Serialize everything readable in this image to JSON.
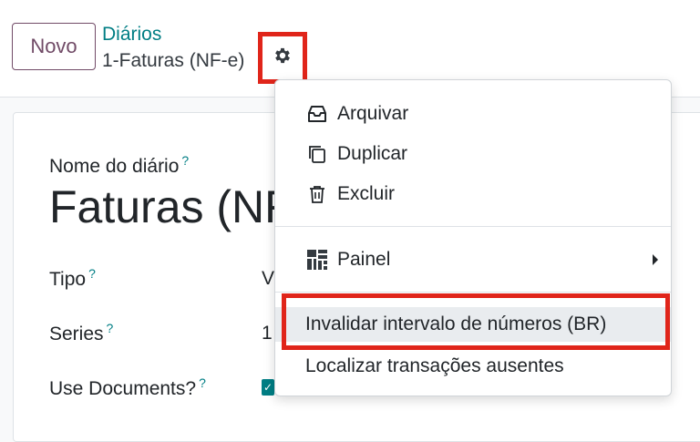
{
  "control_panel": {
    "new_button": "Novo",
    "breadcrumb_parent": "Diários",
    "record_name": "1-Faturas (NF-e)"
  },
  "form": {
    "name_label": "Nome do diário",
    "name_value": "Faturas (NF-e)",
    "type_label": "Tipo",
    "type_value": "V",
    "series_label": "Series",
    "series_value": "1",
    "use_documents_label": "Use Documents?",
    "tooltip_mark": "?"
  },
  "action_menu": {
    "items": [
      {
        "label": "Arquivar",
        "icon": "archive-icon"
      },
      {
        "label": "Duplicar",
        "icon": "copy-icon"
      },
      {
        "label": "Excluir",
        "icon": "trash-icon"
      },
      {
        "label": "Painel",
        "icon": "dashboard-icon"
      },
      {
        "label": "Invalidar intervalo de números (BR)"
      },
      {
        "label": "Localizar transações ausentes"
      }
    ]
  },
  "colors": {
    "brand": "#714b67",
    "link": "#017e84",
    "annotation_red": "#e0251a"
  }
}
